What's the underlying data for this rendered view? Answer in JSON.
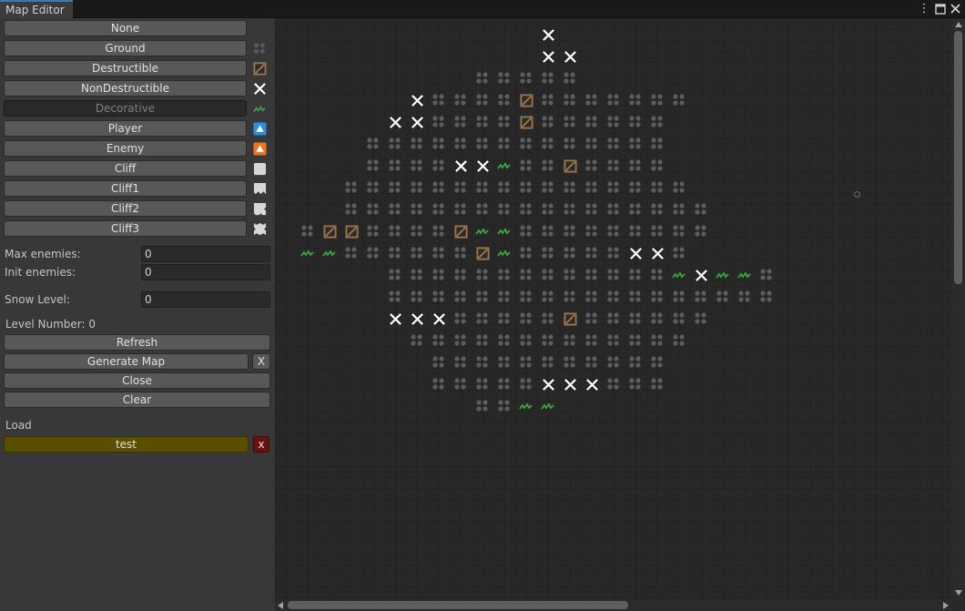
{
  "window": {
    "tab_title": "Map Editor",
    "menu_icon": "kebab-menu-icon",
    "maximize_icon": "maximize-icon",
    "close_icon": "close-icon"
  },
  "tools": [
    {
      "label": "None",
      "icon": "",
      "selected": false
    },
    {
      "label": "Ground",
      "icon": "ground-icon",
      "selected": false
    },
    {
      "label": "Destructible",
      "icon": "destructible-crate-icon",
      "selected": false
    },
    {
      "label": "NonDestructible",
      "icon": "nondestructible-x-icon",
      "selected": false
    },
    {
      "label": "Decorative",
      "icon": "grass-decoration-icon",
      "selected": true
    },
    {
      "label": "Player",
      "icon": "player-triangle-icon",
      "selected": false
    },
    {
      "label": "Enemy",
      "icon": "enemy-triangle-icon",
      "selected": false
    },
    {
      "label": "Cliff",
      "icon": "cliff-icon",
      "selected": false
    },
    {
      "label": "Cliff1",
      "icon": "cliff1-icon",
      "selected": false
    },
    {
      "label": "Cliff2",
      "icon": "cliff2-icon",
      "selected": false
    },
    {
      "label": "Cliff3",
      "icon": "cliff3-icon",
      "selected": false
    }
  ],
  "colors": {
    "accent": "#3a79bb",
    "crate": "#9a7650",
    "grass": "#3aa83a",
    "player": "#2a8ee6",
    "enemy": "#ee7520",
    "load_item": "#5a4e00",
    "delete": "#6a1010"
  },
  "fields": {
    "max_enemies_label": "Max enemies:",
    "max_enemies_value": "0",
    "init_enemies_label": "Init enemies:",
    "init_enemies_value": "0",
    "snow_level_label": "Snow Level:",
    "snow_level_value": "0"
  },
  "level_number": "Level Number: 0",
  "actions": {
    "refresh": "Refresh",
    "generate_map": "Generate Map",
    "generate_clear": "X",
    "close": "Close",
    "clear": "Clear"
  },
  "load": {
    "label": "Load",
    "item": "test",
    "delete": "x"
  },
  "map": {
    "origin_x_cell": 1,
    "grid_rows": [
      {
        "row": 0,
        "start": 11,
        "codes": ".X"
      },
      {
        "row": 1,
        "start": 11,
        "codes": ".XX"
      },
      {
        "row": 2,
        "start": 9,
        "codes": "GGGGG"
      },
      {
        "row": 3,
        "start": 6,
        "codes": "XGGGGDGGGGGGG"
      },
      {
        "row": 4,
        "start": 5,
        "codes": "XXGGGGDGGGGGG"
      },
      {
        "row": 5,
        "start": 4,
        "codes": "GGGGGGGGGGGGGG"
      },
      {
        "row": 6,
        "start": 4,
        "codes": "GGGGXXeGGDGGGG"
      },
      {
        "row": 7,
        "start": 3,
        "codes": "GGGGGGGGGGGGGGGG"
      },
      {
        "row": 8,
        "start": 3,
        "codes": "GGGGGGGGGGGGGGGGG"
      },
      {
        "row": 9,
        "start": 1,
        "codes": "GDDGGGGDeeGGGGGGGGG"
      },
      {
        "row": 10,
        "start": 1,
        "codes": "eeGGGGGGDeGGGGGXXG"
      },
      {
        "row": 11,
        "start": 5,
        "codes": "GGGGGGGGGGGGGeXeeG"
      },
      {
        "row": 12,
        "start": 5,
        "codes": "GGGGGGGGGGGGGGGGGG"
      },
      {
        "row": 13,
        "start": 5,
        "codes": "XXXGGGGGDGGGGGG"
      },
      {
        "row": 14,
        "start": 6,
        "codes": "GGGGGGGGGGGGG"
      },
      {
        "row": 15,
        "start": 7,
        "codes": "GGGGGGGGGGG"
      },
      {
        "row": 16,
        "start": 7,
        "codes": "GGGGGXXXGGG"
      },
      {
        "row": 17,
        "start": 9,
        "codes": "GGee"
      }
    ],
    "legend": {
      "G": "ground",
      "D": "destructible",
      "X": "nondestructible",
      "e": "decorative",
      ".": "empty"
    }
  }
}
